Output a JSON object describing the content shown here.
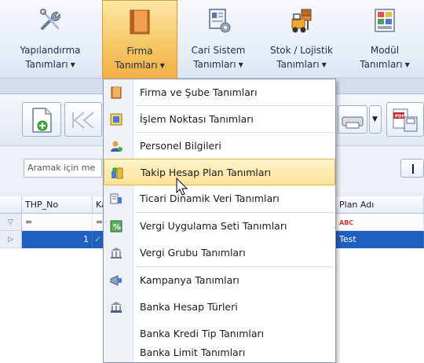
{
  "ribbon": {
    "buttons": [
      {
        "line1": "Yapılandırma",
        "line2": "Tanımları",
        "icon": "tools-icon"
      },
      {
        "line1": "Firma",
        "line2": "Tanımları",
        "icon": "firm-folder-icon",
        "active": true
      },
      {
        "line1": "Cari Sistem",
        "line2": "Tanımları",
        "icon": "cari-system-icon"
      },
      {
        "line1": "Stok / Lojistik",
        "line2": "Tanımları",
        "icon": "forklift-icon"
      },
      {
        "line1": "Modül",
        "line2": "Tanımları",
        "icon": "module-grid-icon"
      }
    ]
  },
  "search": {
    "placeholder": "Aramak için me"
  },
  "grid": {
    "headers": [
      "THP_No",
      "Ka",
      "Plan Adı"
    ],
    "filter_row": [
      "=",
      "=",
      "ABC"
    ],
    "selected_row": {
      "thp_no": "1",
      "plan_adi": "Test"
    }
  },
  "menu": {
    "items": [
      {
        "label": "Firma ve Şube Tanımları",
        "icon": "firm-branch-icon"
      },
      {
        "label": "İşlem Noktası Tanımları",
        "icon": "transaction-point-icon"
      },
      {
        "label": "Personel Bilgileri",
        "icon": "personnel-icon"
      },
      {
        "label": "Takip Hesap Plan Tanımları",
        "icon": "account-plan-icon",
        "highlighted": true
      },
      {
        "label": "Ticari Dinamik Veri Tanımları",
        "icon": "dynamic-data-icon"
      },
      {
        "label": "Vergi Uygulama Seti Tanımları",
        "icon": "tax-set-icon"
      },
      {
        "label": "Vergi Grubu Tanımları",
        "icon": "tax-group-icon"
      },
      {
        "label": "Kampanya Tanımları",
        "icon": "campaign-icon"
      },
      {
        "label": "Banka Hesap Türleri",
        "icon": "bank-icon"
      },
      {
        "label": "Banka Kredi Tip Tanımları",
        "icon": ""
      },
      {
        "label": "Banka Limit Tanımları",
        "icon": ""
      }
    ]
  }
}
